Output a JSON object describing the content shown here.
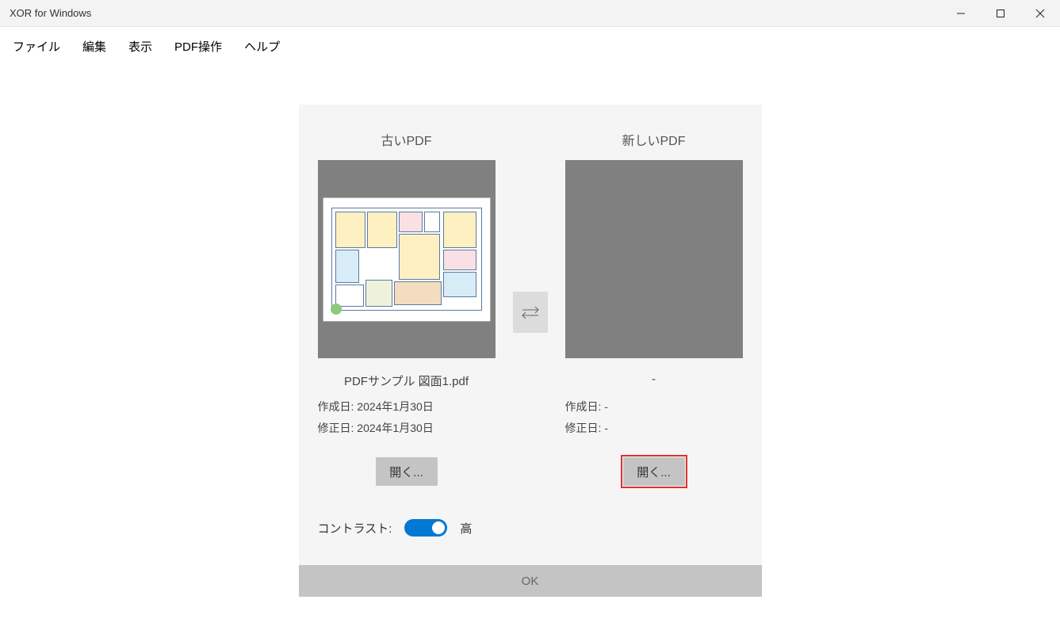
{
  "window": {
    "title": "XOR for Windows"
  },
  "menu": {
    "file": "ファイル",
    "edit": "編集",
    "view": "表示",
    "pdf": "PDF操作",
    "help": "ヘルプ"
  },
  "dialog": {
    "old": {
      "heading": "古いPDF",
      "filename": "PDFサンプル 図面1.pdf",
      "created_label": "作成日:",
      "created_value": "2024年1月30日",
      "modified_label": "修正日:",
      "modified_value": "2024年1月30日",
      "open": "開く..."
    },
    "new": {
      "heading": "新しいPDF",
      "filename": "-",
      "created_label": "作成日:",
      "created_value": "-",
      "modified_label": "修正日:",
      "modified_value": "-",
      "open": "開く..."
    },
    "contrast": {
      "label": "コントラスト:",
      "value": "高",
      "on": true
    },
    "ok": "OK"
  }
}
